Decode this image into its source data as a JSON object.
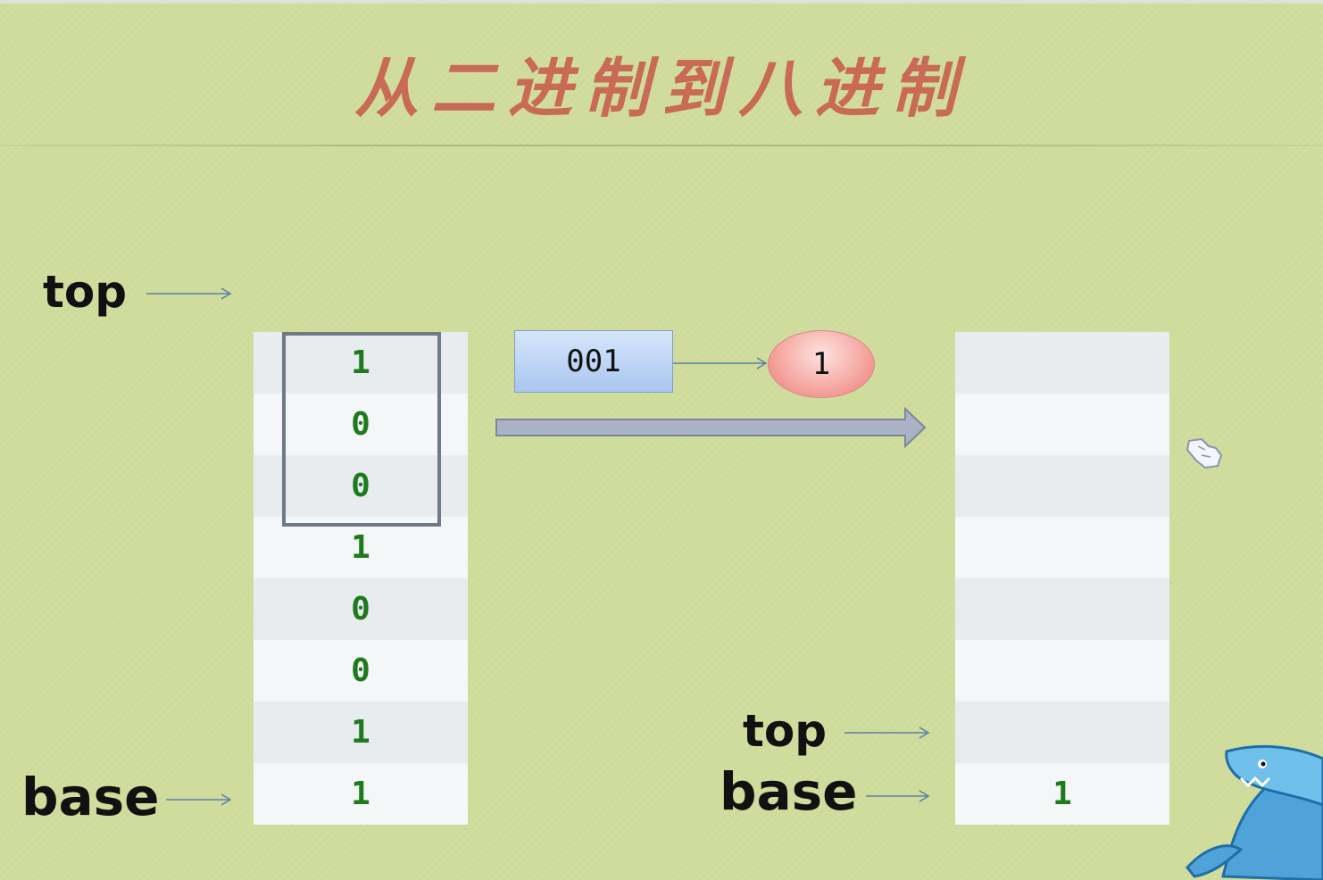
{
  "title": "从二进制到八进制",
  "left_stack": {
    "top_label": "top",
    "base_label": "base",
    "cells": [
      "1",
      "0",
      "0",
      "1",
      "0",
      "0",
      "1",
      "1"
    ]
  },
  "binary_group": "001",
  "octal_digit": "1",
  "right_stack": {
    "top_label": "top",
    "base_label": "base",
    "cells": [
      "",
      "",
      "",
      "",
      "",
      "",
      "",
      "1"
    ]
  },
  "colors": {
    "background": "#cfdb9a",
    "title": "#c86a55",
    "digit": "#1d7a1d",
    "highlight_border": "#6f7a86"
  },
  "icons": [
    "hand-cursor-icon",
    "shark-mascot-icon"
  ]
}
